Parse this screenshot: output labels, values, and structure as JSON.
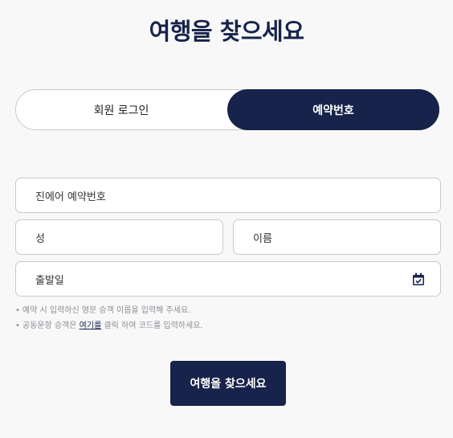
{
  "page": {
    "title": "여행을 찾으세요"
  },
  "toggle": {
    "options": [
      {
        "label": "회원 로그인",
        "selected": false
      },
      {
        "label": "예약번호",
        "selected": true
      }
    ]
  },
  "form": {
    "booking_number_placeholder": "진에어 예약번호",
    "last_name_placeholder": "성",
    "first_name_placeholder": "이름",
    "departure_date_placeholder": "출발일"
  },
  "notes": [
    {
      "bullet": "•",
      "text": "예약 시 입력하신 영문 승객 이름을 입력해 주세요."
    },
    {
      "bullet": "•",
      "prefix": "공동운항 승객은 ",
      "link": "여기를",
      "suffix": " 클릭 하여 코드를 입력하세요."
    }
  ],
  "submit": {
    "label": "여행을 찾으세요"
  },
  "colors": {
    "primary": "#17234a",
    "border": "#c7c9cf",
    "background": "#f8f8f8"
  },
  "icons": {
    "calendar": "calendar-check-icon"
  }
}
